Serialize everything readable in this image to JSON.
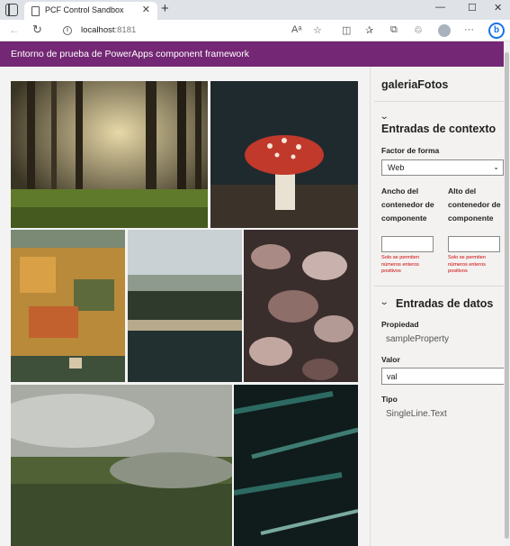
{
  "browser": {
    "tab_title": "PCF Control Sandbox",
    "url_host": "localhost",
    "url_port": ":8181"
  },
  "app": {
    "header_title": "Entorno de prueba de PowerApps component framework"
  },
  "gallery": {
    "photos": [
      {
        "subject": "sunlit-forest",
        "colors": [
          "#2c2a1c",
          "#c7b886",
          "#5a7a2a"
        ]
      },
      {
        "subject": "red-mushroom",
        "colors": [
          "#1f2a2f",
          "#c0392b",
          "#e8e0d0"
        ]
      },
      {
        "subject": "autumn-hillside",
        "colors": [
          "#6b7c6a",
          "#d08a2e",
          "#3e4f3a"
        ]
      },
      {
        "subject": "misty-lake",
        "colors": [
          "#b9c2c6",
          "#2f3a2d",
          "#1c2a2c"
        ]
      },
      {
        "subject": "dry-leaves",
        "colors": [
          "#3a2e2d",
          "#c2a6a0",
          "#6e5250"
        ]
      },
      {
        "subject": "foggy-forest",
        "colors": [
          "#a7aba4",
          "#3b4b2c",
          "#6f7a55"
        ]
      },
      {
        "subject": "fir-branches",
        "colors": [
          "#0f1c1b",
          "#2c6a62",
          "#7aa9a0"
        ]
      }
    ]
  },
  "panel": {
    "title": "galeriaFotos",
    "context_section": "Entradas de contexto",
    "form_factor_label": "Factor de forma",
    "form_factor_value": "Web",
    "width_label": "Ancho del contenedor de componente",
    "height_label": "Alto del contenedor de componente",
    "width_value": "",
    "height_value": "",
    "int_error": "Solo se permiten números enteros positivos",
    "data_section": "Entradas de datos",
    "property_label": "Propiedad",
    "property_value": "sampleProperty",
    "value_label": "Valor",
    "value_value": "val",
    "type_label": "Tipo",
    "type_value": "SingleLine.Text"
  }
}
